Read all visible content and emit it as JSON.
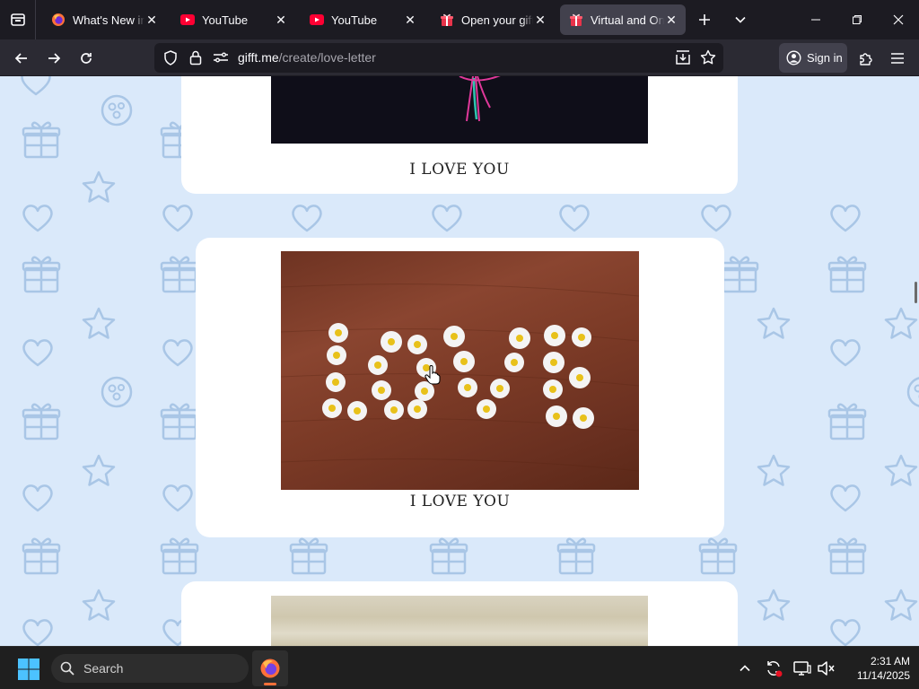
{
  "browser": {
    "tabs": [
      {
        "title": "What's New in Firefox",
        "favicon": "firefox-icon",
        "active": false
      },
      {
        "title": "YouTube",
        "favicon": "youtube-icon",
        "active": false
      },
      {
        "title": "YouTube",
        "favicon": "youtube-icon",
        "active": false
      },
      {
        "title": "Open your gift - ",
        "favicon": "gift-icon",
        "active": false
      },
      {
        "title": "Virtual and Online",
        "favicon": "gift-icon",
        "active": true
      }
    ],
    "url_host": "gifft.me",
    "url_path": "/create/love-letter",
    "sign_in_label": "Sign in"
  },
  "page": {
    "cards": [
      {
        "caption": "I LOVE YOU"
      },
      {
        "caption": "I LOVE YOU"
      },
      {
        "caption": ""
      }
    ],
    "background_color": "#dae9fa",
    "pattern_color": "#a9c6e6"
  },
  "taskbar": {
    "search_label": "Search",
    "time": "2:31 AM",
    "date": "11/14/2025"
  }
}
